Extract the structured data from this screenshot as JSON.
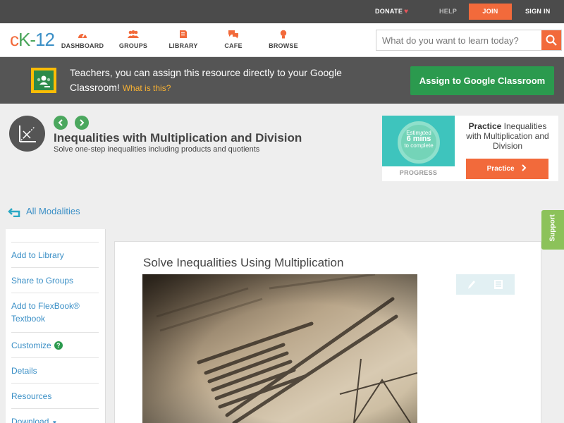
{
  "topbar": {
    "donate": "DONATE",
    "help": "HELP",
    "join": "JOIN",
    "signin": "SIGN IN"
  },
  "logo": {
    "c": "c",
    "k": "K",
    "dash": "-",
    "n": "12"
  },
  "nav": [
    {
      "label": "DASHBOARD",
      "icon": "dashboard-icon"
    },
    {
      "label": "GROUPS",
      "icon": "groups-icon"
    },
    {
      "label": "LIBRARY",
      "icon": "library-icon"
    },
    {
      "label": "CAFE",
      "icon": "cafe-icon"
    },
    {
      "label": "BROWSE",
      "icon": "browse-icon"
    }
  ],
  "search": {
    "placeholder": "What do you want to learn today?"
  },
  "banner": {
    "text": "Teachers, you can assign this resource directly to your Google Classroom!",
    "what_is": "What is this?",
    "assign_label": "Assign to Google Classroom"
  },
  "concept": {
    "title": "Inequalities with Multiplication and Division",
    "subtitle": "Solve one-step inequalities including products and quotients"
  },
  "practice": {
    "estimated": "Estimated",
    "mins": "6 mins",
    "to_complete": "to complete",
    "progress": "PROGRESS",
    "heading_bold": "Practice",
    "heading_rest": "Inequalities with Multiplication and Division",
    "button": "Practice"
  },
  "all_modalities": "All Modalities",
  "sidebar": {
    "items": [
      "Add to Library",
      "Share to Groups",
      "Add to FlexBook® Textbook",
      "Customize",
      "Details",
      "Resources",
      "Download"
    ],
    "customize_help": "?",
    "download_caret": "▼"
  },
  "content": {
    "title": "Solve Inequalities Using Multiplication"
  },
  "support": "Support",
  "colors": {
    "orange": "#f26a3b",
    "green": "#2b9a4e",
    "blue": "#3a8fc6",
    "support_green": "#8cc25a"
  }
}
